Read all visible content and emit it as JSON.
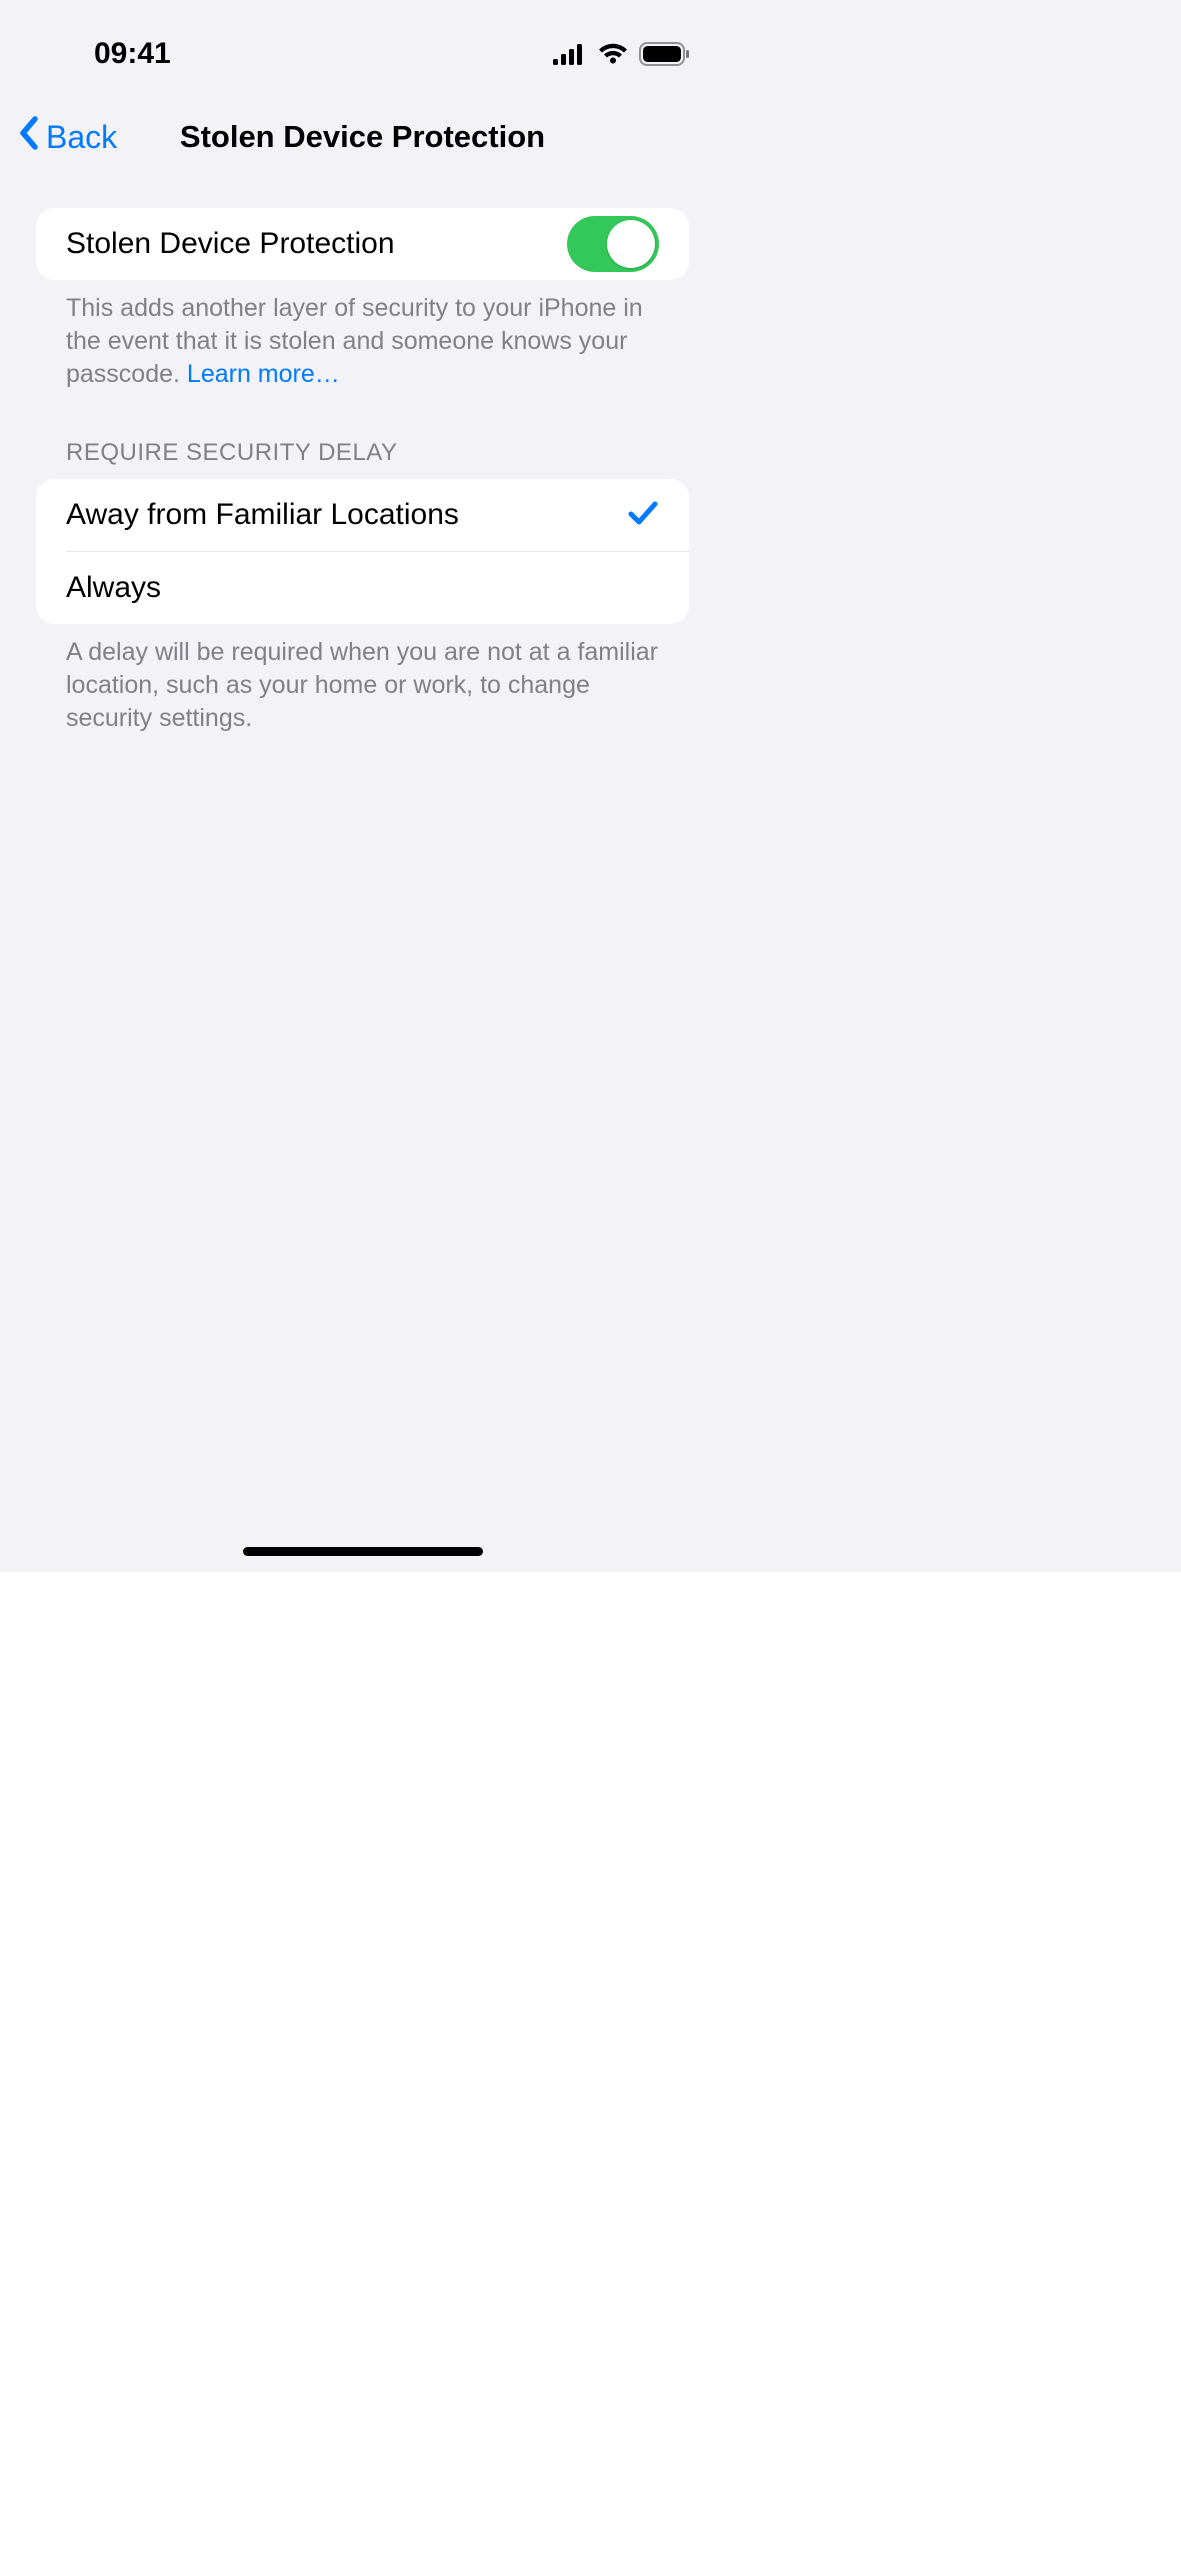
{
  "status": {
    "time": "09:41"
  },
  "nav": {
    "back_label": "Back",
    "title": "Stolen Device Protection"
  },
  "main_toggle": {
    "label": "Stolen Device Protection",
    "on": true
  },
  "main_footer": {
    "text": "This adds another layer of security to your iPhone in the event that it is stolen and someone knows your passcode. ",
    "link": "Learn more…"
  },
  "delay_section": {
    "header": "REQUIRE SECURITY DELAY",
    "options": [
      {
        "label": "Away from Familiar Locations",
        "selected": true
      },
      {
        "label": "Always",
        "selected": false
      }
    ],
    "footer": "A delay will be required when you are not at a familiar location, such as your home or work, to change security settings."
  }
}
